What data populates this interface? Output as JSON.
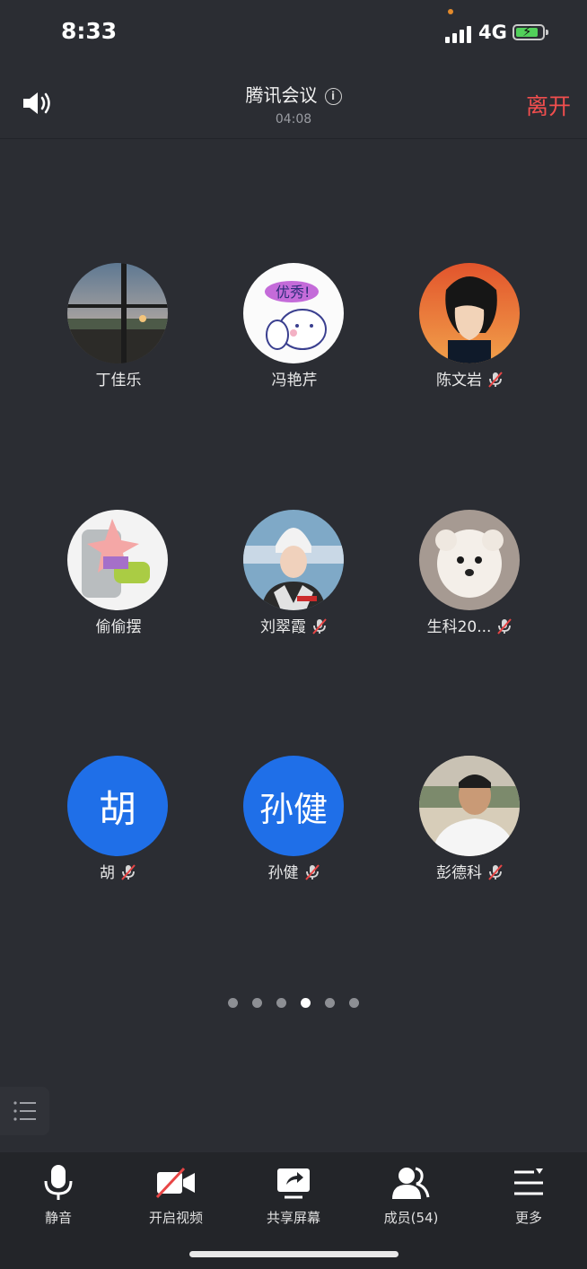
{
  "status_bar": {
    "time": "8:33",
    "network": "4G"
  },
  "header": {
    "title": "腾讯会议",
    "duration": "04:08",
    "leave_label": "离开"
  },
  "participants": [
    {
      "name": "丁佳乐",
      "muted": false,
      "avatar": "photo"
    },
    {
      "name": "冯艳芹",
      "muted": false,
      "avatar": "photo"
    },
    {
      "name": "陈文岩",
      "muted": true,
      "avatar": "photo"
    },
    {
      "name": "偷偷摆",
      "muted": false,
      "avatar": "photo"
    },
    {
      "name": "刘翠霞",
      "muted": true,
      "avatar": "photo"
    },
    {
      "name": "生科20...",
      "muted": true,
      "avatar": "photo"
    },
    {
      "name": "胡",
      "muted": true,
      "avatar": "text",
      "avatar_text": "胡"
    },
    {
      "name": "孙健",
      "muted": true,
      "avatar": "text",
      "avatar_text": "孙健"
    },
    {
      "name": "彭德科",
      "muted": true,
      "avatar": "photo"
    }
  ],
  "pager": {
    "pages": 6,
    "current": 4
  },
  "toolbar": {
    "mute_label": "静音",
    "video_label": "开启视频",
    "share_label": "共享屏幕",
    "members_label": "成员(54)",
    "more_label": "更多"
  },
  "colors": {
    "accent_blue": "#1f6fe8",
    "leave_red": "#f24e4e",
    "background": "#2b2d33"
  }
}
